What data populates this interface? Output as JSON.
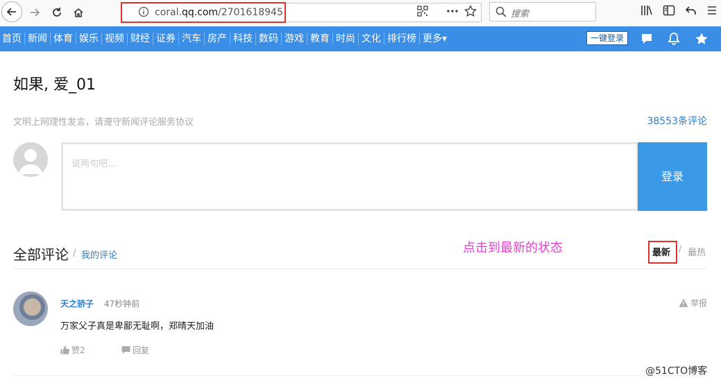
{
  "browser": {
    "url_prefix": "coral.",
    "url_domain": "qq.com",
    "url_path": "/2701618945",
    "search_placeholder": "搜索"
  },
  "nav": {
    "items": [
      "首页",
      "新闻",
      "体育",
      "娱乐",
      "视频",
      "财经",
      "证券",
      "汽车",
      "房产",
      "科技",
      "数码",
      "游戏",
      "教育",
      "时尚",
      "文化",
      "排行榜",
      "更多▾"
    ],
    "login_label": "一键登录"
  },
  "page": {
    "title": "如果, 爱_01",
    "notice": "文明上网理性发言，请遵守新闻评论服务协议",
    "comment_count": "38553条评论",
    "input_placeholder": "说两句吧...",
    "submit_label": "登录"
  },
  "comments_section": {
    "title": "全部评论",
    "separator": "/",
    "my_comments": "我的评论",
    "annotation": "点击到最新的状态",
    "sort_newest": "最新",
    "sort_separator": "/",
    "sort_hot": "最热"
  },
  "comment": {
    "username": "天之骄子",
    "time": "47秒钟前",
    "report_label": "举报",
    "text": "万家父子真是卑鄙无耻啊，郑晴天加油",
    "like_label": "赞2",
    "reply_label": "回复"
  },
  "watermark": "@51CTO博客",
  "colors": {
    "nav_bg": "#3a8ee6",
    "link": "#2f7dc9",
    "submit_bg": "#3a9ae8",
    "annotation": "#e63fd0",
    "highlight_box": "#e0302b"
  }
}
